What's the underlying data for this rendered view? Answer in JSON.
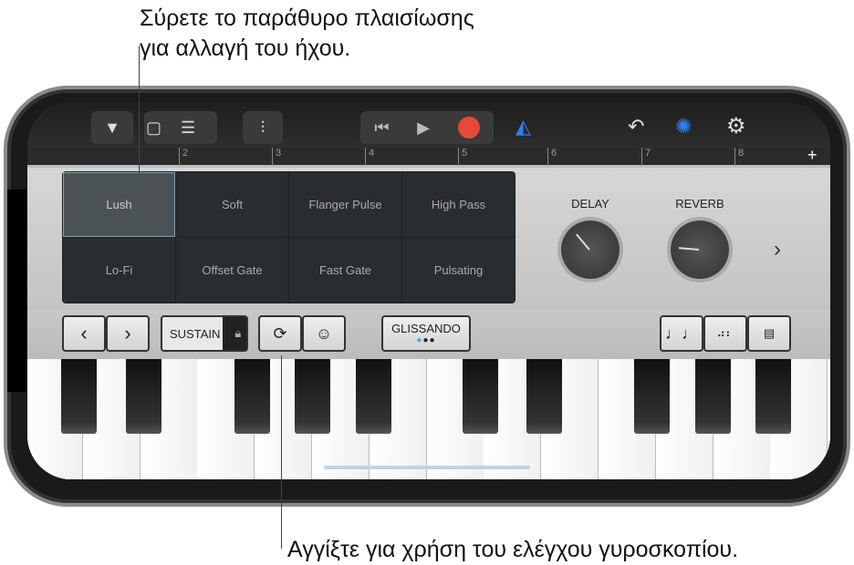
{
  "callouts": {
    "top_line1": "Σύρετε το παράθυρο πλαισίωσης",
    "top_line2": "για αλλαγή του ήχου.",
    "bottom": "Αγγίξτε για χρήση του ελέγχου γυροσκοπίου."
  },
  "ruler": {
    "marks": [
      "2",
      "3",
      "4",
      "5",
      "6",
      "7",
      "8"
    ],
    "add": "+"
  },
  "pads": [
    "Lush",
    "Soft",
    "Flanger Pulse",
    "High Pass",
    "Lo-Fi",
    "Offset Gate",
    "Fast Gate",
    "Pulsating"
  ],
  "selected_pad": "Lush",
  "knobs": {
    "delay": {
      "label": "DELAY",
      "angle_deg": -130
    },
    "reverb": {
      "label": "REVERB",
      "angle_deg": -175
    }
  },
  "controls": {
    "prev": "‹",
    "next": "›",
    "sustain": "SUSTAIN",
    "glissando": "GLISSANDO",
    "next_panel": "›"
  },
  "colors": {
    "accent": "#2f7ff0",
    "record": "#e8483a"
  }
}
